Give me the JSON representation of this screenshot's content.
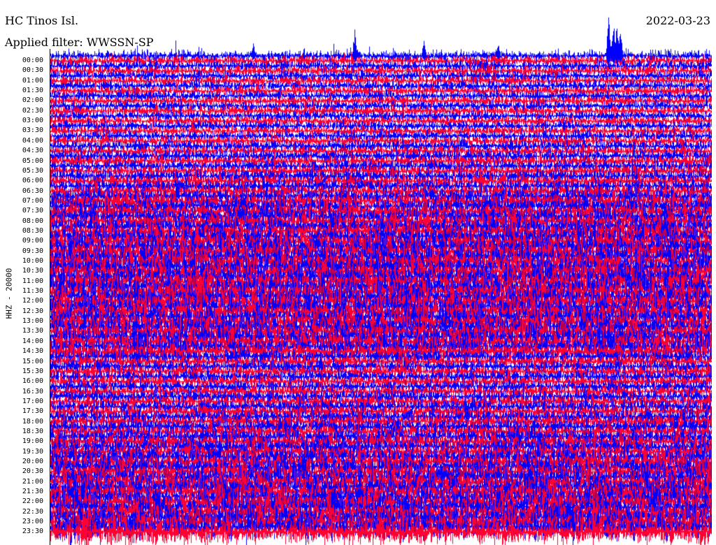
{
  "header": {
    "station": "HC Tinos Isl.",
    "date": "2022-03-23",
    "filter": "Applied filter: WWSSN-SP"
  },
  "chart_data": {
    "type": "line",
    "title": "HC Tinos Isl.",
    "date": "2022-03-23",
    "subtitle": "Applied filter: WWSSN-SP",
    "ylabel": "HHZ - 20000",
    "xlabel": "",
    "y_ticks": [
      "00:00",
      "00:30",
      "01:00",
      "01:30",
      "02:00",
      "02:30",
      "03:00",
      "03:30",
      "04:00",
      "04:30",
      "05:00",
      "05:30",
      "06:00",
      "06:30",
      "07:00",
      "07:30",
      "08:00",
      "08:30",
      "09:00",
      "09:30",
      "10:00",
      "10:30",
      "11:00",
      "11:30",
      "12:00",
      "12:30",
      "13:00",
      "13:30",
      "14:00",
      "14:30",
      "15:00",
      "15:30",
      "16:00",
      "16:30",
      "17:00",
      "17:30",
      "18:00",
      "18:30",
      "19:00",
      "19:30",
      "20:00",
      "20:30",
      "21:00",
      "21:30",
      "22:00",
      "22:30",
      "23:00",
      "23:30"
    ],
    "trace_colors": [
      "#0000ff",
      "#ff0033"
    ],
    "row_minutes": 15,
    "row_count": 96,
    "grid": false,
    "legend": "none",
    "relative_amplitude_by_hour": [
      {
        "hour": 0,
        "level": 0.35
      },
      {
        "hour": 1,
        "level": 0.32
      },
      {
        "hour": 2,
        "level": 0.32
      },
      {
        "hour": 3,
        "level": 0.3
      },
      {
        "hour": 4,
        "level": 0.35
      },
      {
        "hour": 5,
        "level": 0.45
      },
      {
        "hour": 6,
        "level": 0.55
      },
      {
        "hour": 7,
        "level": 0.75
      },
      {
        "hour": 8,
        "level": 0.85
      },
      {
        "hour": 9,
        "level": 0.95
      },
      {
        "hour": 10,
        "level": 1.0
      },
      {
        "hour": 11,
        "level": 1.0
      },
      {
        "hour": 12,
        "level": 1.0
      },
      {
        "hour": 13,
        "level": 0.95
      },
      {
        "hour": 14,
        "level": 0.9
      },
      {
        "hour": 15,
        "level": 0.5
      },
      {
        "hour": 16,
        "level": 0.45
      },
      {
        "hour": 17,
        "level": 0.55
      },
      {
        "hour": 18,
        "level": 0.6
      },
      {
        "hour": 19,
        "level": 0.75
      },
      {
        "hour": 20,
        "level": 0.85
      },
      {
        "hour": 21,
        "level": 0.95
      },
      {
        "hour": 22,
        "level": 1.0
      },
      {
        "hour": 23,
        "level": 1.1
      }
    ]
  }
}
